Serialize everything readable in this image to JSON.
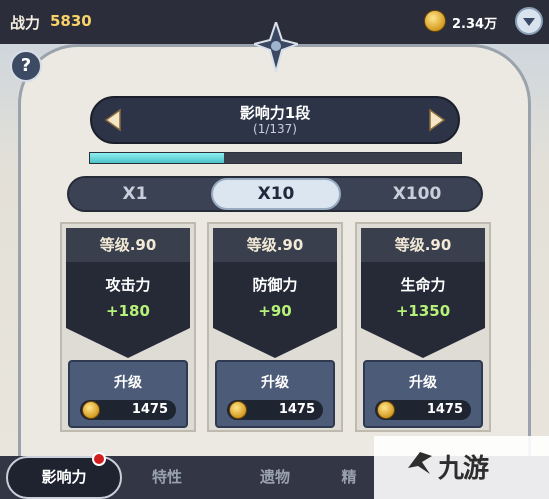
{
  "header": {
    "power_label": "战力",
    "power_value": "5830",
    "coin_amount": "2.34万",
    "coin_icon": "gold-coin-icon",
    "menu_icon": "chevron-down-icon"
  },
  "help": {
    "label": "?"
  },
  "level": {
    "title": "影响力1段",
    "progress_text": "(1/137)",
    "progress_fraction": 0.36
  },
  "multipliers": {
    "options": [
      "X1",
      "X10",
      "X100"
    ],
    "selected": "X10"
  },
  "cards": [
    {
      "level": "等级.90",
      "stat": "攻击力",
      "bonus": "+180",
      "button": "升级",
      "cost": "1475"
    },
    {
      "level": "等级.90",
      "stat": "防御力",
      "bonus": "+90",
      "button": "升级",
      "cost": "1475"
    },
    {
      "level": "等级.90",
      "stat": "生命力",
      "bonus": "+1350",
      "button": "升级",
      "cost": "1475"
    }
  ],
  "tabs": {
    "items": [
      "影响力",
      "特性",
      "遗物",
      "精"
    ],
    "active": "影响力"
  },
  "watermark": {
    "text": "九游"
  },
  "colors": {
    "accent_gold": "#f7d36a",
    "bonus_green": "#b6f27a",
    "progress_cyan": "#4ec2c8",
    "notification_red": "#d41d1d"
  }
}
